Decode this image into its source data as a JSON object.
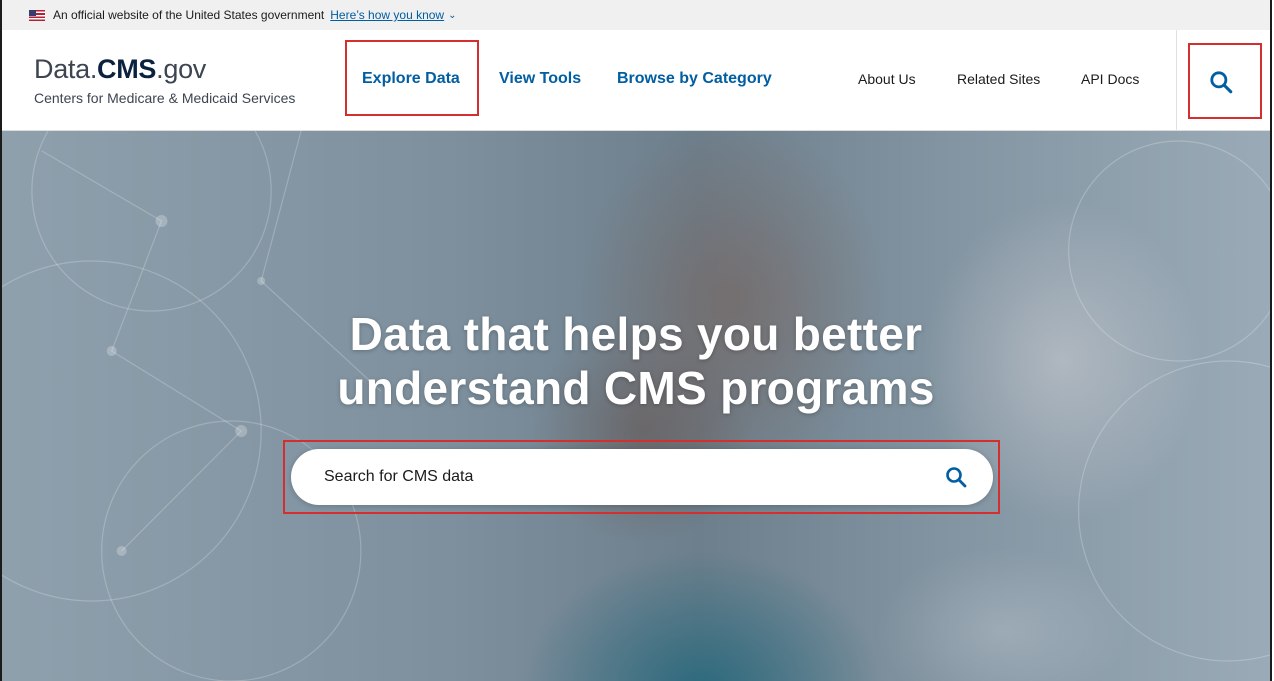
{
  "gov_banner": {
    "flag_icon": "us-flag-icon",
    "text": "An official website of the United States government",
    "link_text": "Here’s how you know",
    "chevron": "⌄"
  },
  "header": {
    "logo": {
      "data": "Data.",
      "cms": "CMS",
      "gov": ".gov",
      "subtitle": "Centers for Medicare & Medicaid Services"
    },
    "nav_primary": [
      "Explore Data",
      "View Tools",
      "Browse by Category"
    ],
    "nav_secondary": [
      "About Us",
      "Related Sites",
      "API Docs"
    ],
    "search_icon": "search-icon"
  },
  "hero": {
    "title_line1": "Data that helps you better",
    "title_line2": "understand CMS programs",
    "search": {
      "placeholder": "Search for CMS data",
      "icon": "search-icon"
    }
  },
  "colors": {
    "primary": "#005ea2",
    "logo_dark": "#0a2240",
    "highlight": "#d32f2f",
    "hero_overlay": "#7e909e"
  }
}
